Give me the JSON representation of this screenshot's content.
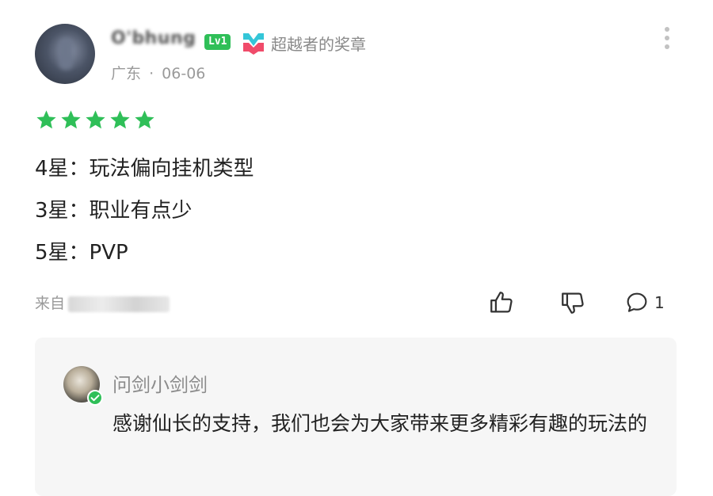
{
  "review": {
    "username": "O'bhung",
    "level": "Lv1",
    "medal_label": "超越者的奖章",
    "location": "广东",
    "separator": "·",
    "date": "06-06",
    "rating": 5,
    "star_color": "#2fbf58",
    "lines": [
      "4星：玩法偏向挂机类型",
      "3星：职业有点少",
      "5星：PVP"
    ],
    "source_prefix": "来自"
  },
  "actions": {
    "like": {
      "icon": "thumbs-up-icon"
    },
    "dislike": {
      "icon": "thumbs-down-icon"
    },
    "reply": {
      "icon": "comment-icon",
      "count": "1"
    }
  },
  "developer_reply": {
    "name": "问剑小剑剑",
    "text": "感谢仙长的支持，我们也会为大家带来更多精彩有趣的玩法的",
    "verified_color": "#2fbf58"
  },
  "icons": {
    "more": "more-vertical-icon",
    "medal": "medal-icon",
    "verified": "verified-check-icon",
    "star": "star-icon"
  }
}
